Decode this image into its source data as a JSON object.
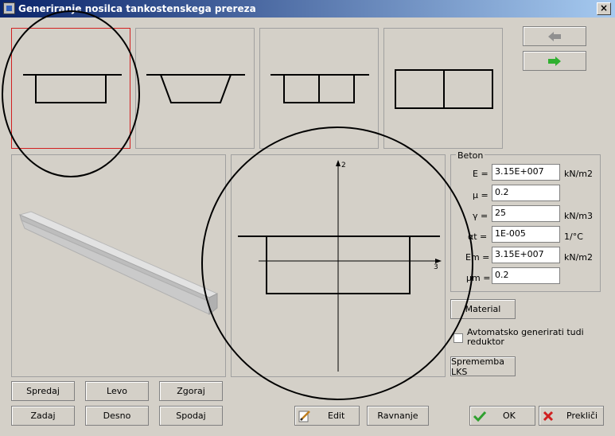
{
  "window": {
    "title": "Generiranje nosilca tankostenskega prereza",
    "close_glyph": "×"
  },
  "nav": {
    "back_icon": "arrow-left-icon",
    "forward_icon": "arrow-right-icon"
  },
  "section_axes": {
    "vertical_label": "2",
    "horizontal_label": "3"
  },
  "beton": {
    "title": "Beton",
    "rows": [
      {
        "label": "E =",
        "value": "3.15E+007",
        "unit": "kN/m2"
      },
      {
        "label": "μ =",
        "value": "0.2",
        "unit": ""
      },
      {
        "label": "γ =",
        "value": "25",
        "unit": "kN/m3"
      },
      {
        "label": "αt =",
        "value": "1E-005",
        "unit": "1/°C"
      },
      {
        "label": "Em =",
        "value": "3.15E+007",
        "unit": "kN/m2"
      },
      {
        "label": "μm =",
        "value": "0.2",
        "unit": ""
      }
    ]
  },
  "buttons": {
    "material": "Material",
    "auto_reductor": "Avtomatsko generirati tudi reduktor",
    "lks": "Sprememba LKS",
    "spredaj": "Spredaj",
    "levo": "Levo",
    "zgoraj": "Zgoraj",
    "zadaj": "Zadaj",
    "desno": "Desno",
    "spodaj": "Spodaj",
    "edit": "Edit",
    "ravnanje": "Ravnanje",
    "ok": "OK",
    "preklici": "Prekliči"
  },
  "colors": {
    "selection_border": "#d22020",
    "ok_check": "#2fa02f",
    "cancel_x": "#d02020",
    "nav_arrow": "#30b030",
    "nav_arrow_disabled": "#909090"
  }
}
